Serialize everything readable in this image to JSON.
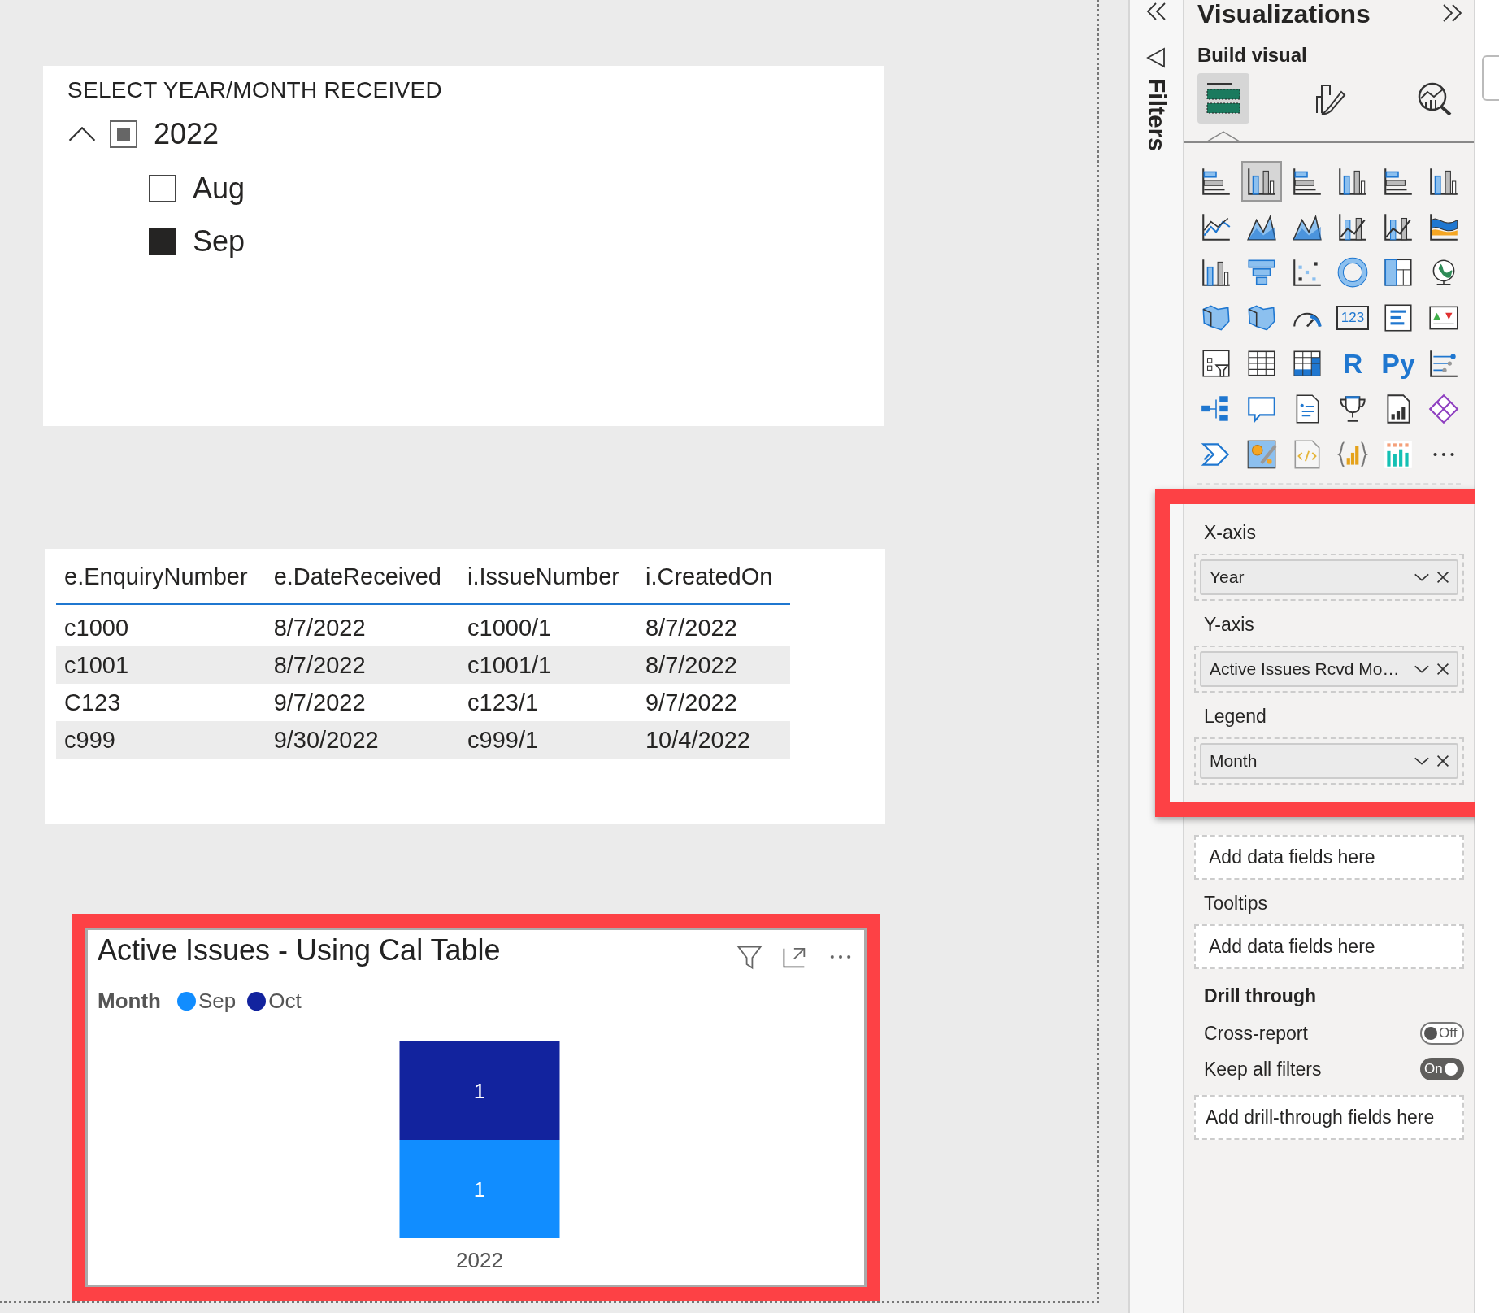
{
  "canvas": {
    "slicer": {
      "title": "SELECT YEAR/MONTH RECEIVED",
      "years": [
        {
          "label": "2022",
          "expanded": true,
          "checked": false,
          "partial": true,
          "months": [
            {
              "label": "Aug",
              "checked": false
            },
            {
              "label": "Sep",
              "checked": true
            }
          ]
        }
      ]
    },
    "table": {
      "columns": [
        "e.EnquiryNumber",
        "e.DateReceived",
        "i.IssueNumber",
        "i.CreatedOn"
      ],
      "rows": [
        [
          "c1000",
          "8/7/2022",
          "c1000/1",
          "8/7/2022"
        ],
        [
          "c1001",
          "8/7/2022",
          "c1001/1",
          "8/7/2022"
        ],
        [
          "C123",
          "9/7/2022",
          "c123/1",
          "9/7/2022"
        ],
        [
          "c999",
          "9/30/2022",
          "c999/1",
          "10/4/2022"
        ]
      ]
    },
    "chart_visual": {
      "title": "Active Issues - Using Cal Table",
      "highlighted": true,
      "legend_title": "Month",
      "chart_data": {
        "type": "bar",
        "stacked": true,
        "orientation": "vertical",
        "categories": [
          "2022"
        ],
        "series": [
          {
            "name": "Sep",
            "color": "#118dff",
            "values": [
              1
            ]
          },
          {
            "name": "Oct",
            "color": "#12239e",
            "values": [
              1
            ]
          }
        ],
        "data_labels": true
      }
    }
  },
  "filters_pane": {
    "label": "Filters"
  },
  "visualizations_pane": {
    "title": "Visualizations",
    "subtitle": "Build visual",
    "tabs": [
      {
        "selected": true
      },
      {
        "selected": false
      },
      {
        "selected": false
      }
    ],
    "visual_types": [
      {
        "kind": "icon",
        "selected": false
      },
      {
        "kind": "icon",
        "selected": true
      },
      {
        "kind": "icon",
        "selected": false
      },
      {
        "kind": "icon",
        "selected": false
      },
      {
        "kind": "icon",
        "selected": false
      },
      {
        "kind": "icon",
        "selected": false
      },
      {
        "kind": "icon",
        "selected": false
      },
      {
        "kind": "icon",
        "selected": false
      },
      {
        "kind": "icon",
        "selected": false
      },
      {
        "kind": "icon",
        "selected": false
      },
      {
        "kind": "icon",
        "selected": false
      },
      {
        "kind": "icon",
        "selected": false
      },
      {
        "kind": "icon",
        "selected": false
      },
      {
        "kind": "icon",
        "selected": false
      },
      {
        "kind": "icon",
        "selected": false
      },
      {
        "kind": "icon",
        "selected": false
      },
      {
        "kind": "icon",
        "selected": false
      },
      {
        "kind": "icon",
        "selected": false
      },
      {
        "kind": "icon",
        "selected": false
      },
      {
        "kind": "icon",
        "selected": false
      },
      {
        "kind": "icon",
        "selected": false
      },
      {
        "kind": "card",
        "label": "123",
        "selected": false
      },
      {
        "kind": "icon",
        "selected": false
      },
      {
        "kind": "icon",
        "selected": false
      },
      {
        "kind": "icon",
        "selected": false
      },
      {
        "kind": "icon",
        "selected": false
      },
      {
        "kind": "icon",
        "selected": false
      },
      {
        "kind": "text",
        "label": "R",
        "selected": false
      },
      {
        "kind": "text",
        "label": "Py",
        "selected": false
      },
      {
        "kind": "icon",
        "selected": false
      },
      {
        "kind": "icon",
        "selected": false
      },
      {
        "kind": "icon",
        "selected": false
      },
      {
        "kind": "icon",
        "selected": false
      },
      {
        "kind": "icon",
        "selected": false
      },
      {
        "kind": "icon",
        "selected": false
      },
      {
        "kind": "icon",
        "selected": false
      },
      {
        "kind": "icon",
        "selected": false
      },
      {
        "kind": "icon",
        "selected": false
      },
      {
        "kind": "icon",
        "selected": false
      },
      {
        "kind": "icon",
        "selected": false
      },
      {
        "kind": "icon",
        "selected": false
      },
      {
        "kind": "icon",
        "selected": false
      }
    ],
    "highlight_fields": true,
    "wells": [
      {
        "label": "X-axis",
        "field": "Year"
      },
      {
        "label": "Y-axis",
        "field": "Active Issues Rcvd Mo…"
      },
      {
        "label": "Legend",
        "field": "Month"
      },
      {
        "prompt": "Add data fields here"
      },
      {
        "label": "Tooltips",
        "prompt": "Add data fields here"
      }
    ],
    "drill_through": {
      "title": "Drill through",
      "toggles": [
        {
          "label": "Cross-report",
          "on": false,
          "state_text": "Off"
        },
        {
          "label": "Keep all filters",
          "on": true,
          "state_text": "On"
        }
      ],
      "prompt": "Add drill-through fields here"
    }
  }
}
